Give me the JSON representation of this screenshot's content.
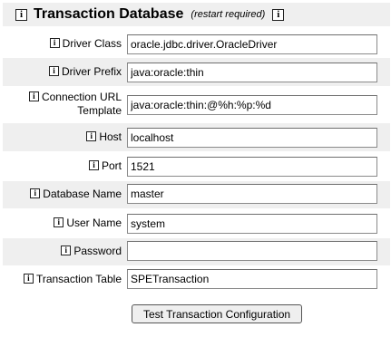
{
  "header": {
    "title": "Transaction Database",
    "note": "(restart required)"
  },
  "info_glyph": "i",
  "fields": {
    "driver_class": {
      "label": "Driver Class",
      "value": "oracle.jdbc.driver.OracleDriver"
    },
    "driver_prefix": {
      "label": "Driver Prefix",
      "value": "java:oracle:thin"
    },
    "connection_url_template": {
      "label_line1": "Connection URL",
      "label_line2": "Template",
      "value": "java:oracle:thin:@%h:%p:%d"
    },
    "host": {
      "label": "Host",
      "value": "localhost"
    },
    "port": {
      "label": "Port",
      "value": "1521"
    },
    "database_name": {
      "label": "Database Name",
      "value": "master"
    },
    "user_name": {
      "label": "User Name",
      "value": "system"
    },
    "password": {
      "label": "Password",
      "value": ""
    },
    "transaction_table": {
      "label": "Transaction Table",
      "value": "SPETransaction"
    }
  },
  "button": {
    "label": "Test Transaction Configuration"
  }
}
